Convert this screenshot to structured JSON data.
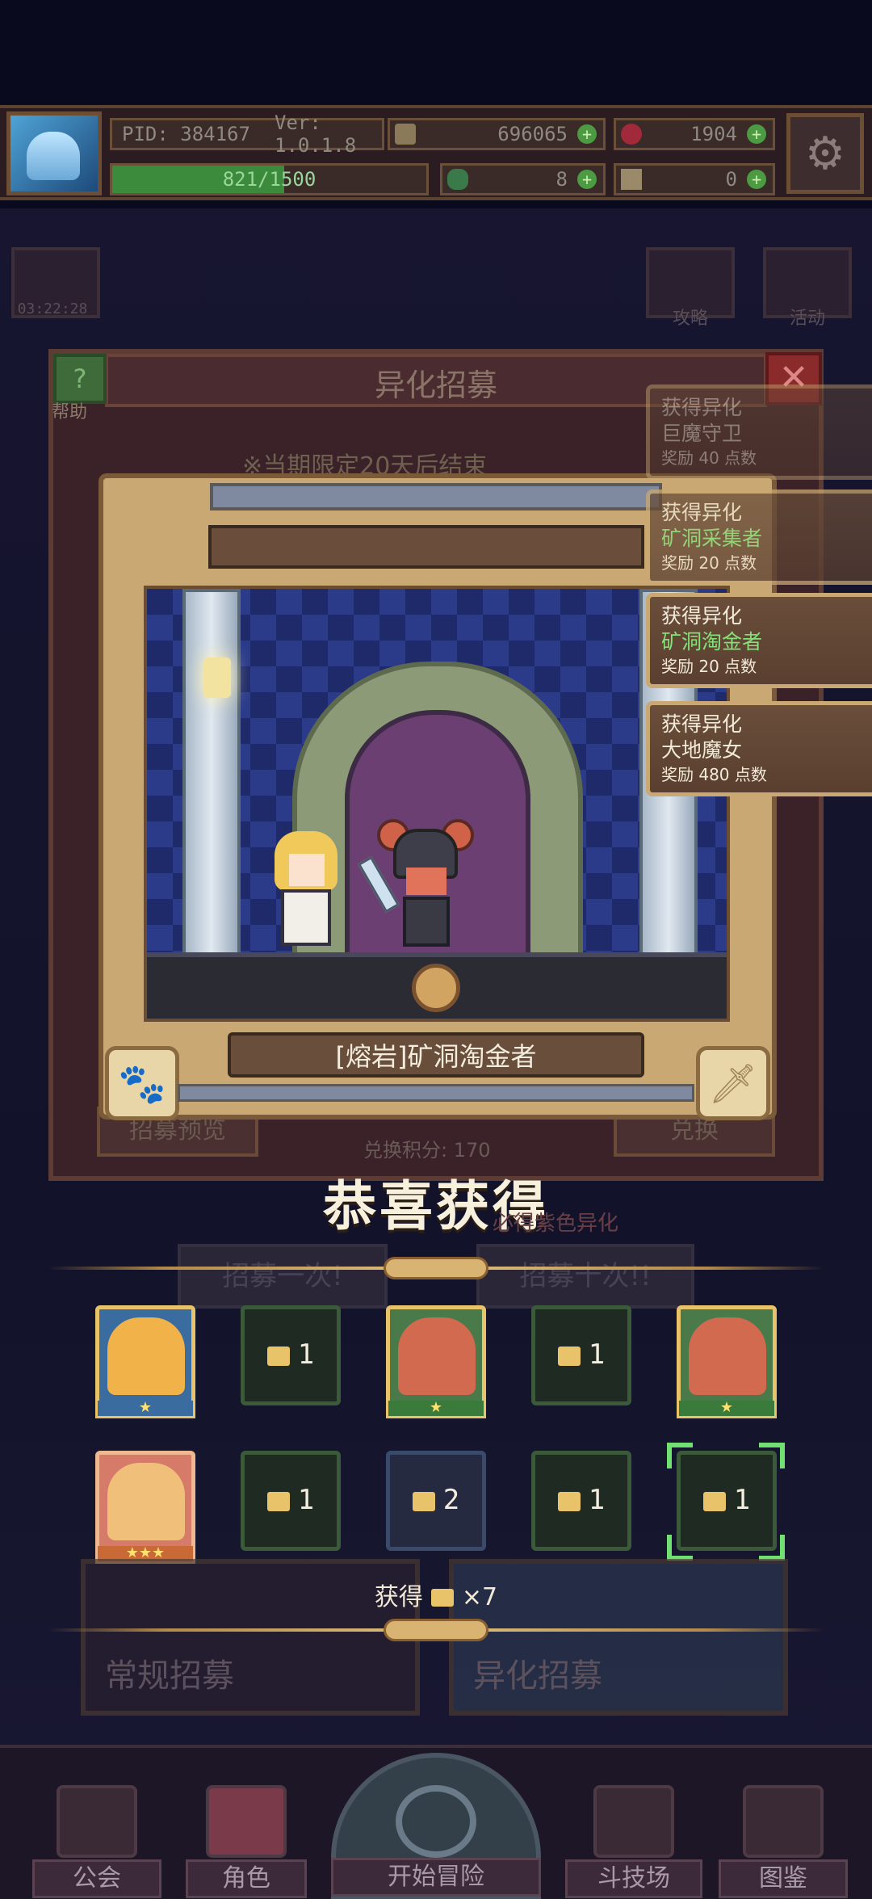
{
  "topbar": {
    "pid": "PID: 384167",
    "version": "Ver: 1.0.1.8",
    "coins": "696065",
    "gems": "1904",
    "xp_text": "821/1500",
    "xp_fraction": 0.547,
    "clovers": "8",
    "keys": "0"
  },
  "timer": "03:22:28",
  "side_buttons": {
    "guide": "攻略",
    "event": "活动"
  },
  "panel": {
    "title": "异化招募",
    "help": "帮助",
    "limit_note": "※当期限定20天后结束",
    "exchange_score": "兑换积分: 170",
    "preview": "招募预览",
    "exchange": "兑换",
    "promise": "必得紫色异化",
    "recruit_once": "招募一次!",
    "recruit_ten": "招募十次!!"
  },
  "card": {
    "name": "[熔岩]矿洞淘金者"
  },
  "toasts": [
    {
      "line1": "获得异化",
      "line2": "巨魔守卫",
      "line3": "奖励 40 点数"
    },
    {
      "line1": "获得异化",
      "line2": "矿洞采集者",
      "line3": "奖励 20 点数"
    },
    {
      "line1": "获得异化",
      "line2": "矿洞淘金者",
      "line3": "奖励 20 点数"
    },
    {
      "line1": "获得异化",
      "line2": "大地魔女",
      "line3": "奖励 480 点数"
    }
  ],
  "congrats": "恭喜获得",
  "rewards": {
    "row1": [
      {
        "kind": "portrait",
        "stars": "★"
      },
      {
        "kind": "token",
        "count": "1"
      },
      {
        "kind": "portrait",
        "stars": "★"
      },
      {
        "kind": "token",
        "count": "1"
      },
      {
        "kind": "portrait",
        "stars": "★"
      }
    ],
    "row2": [
      {
        "kind": "portrait",
        "stars": "★★★"
      },
      {
        "kind": "token",
        "count": "1"
      },
      {
        "kind": "token",
        "count": "2"
      },
      {
        "kind": "token",
        "count": "1"
      },
      {
        "kind": "token",
        "count": "1"
      }
    ]
  },
  "obtained": {
    "label": "获得",
    "count": "×7"
  },
  "tabs": {
    "normal": "常规招募",
    "mutant": "异化招募"
  },
  "nav": {
    "guild": "公会",
    "character": "角色",
    "adventure": "开始冒险",
    "arena": "斗技场",
    "codex": "图鉴"
  },
  "colors": {
    "accent_gold": "#e8c36a",
    "toast_green": "#86e07a",
    "selection_green": "#70e070"
  }
}
